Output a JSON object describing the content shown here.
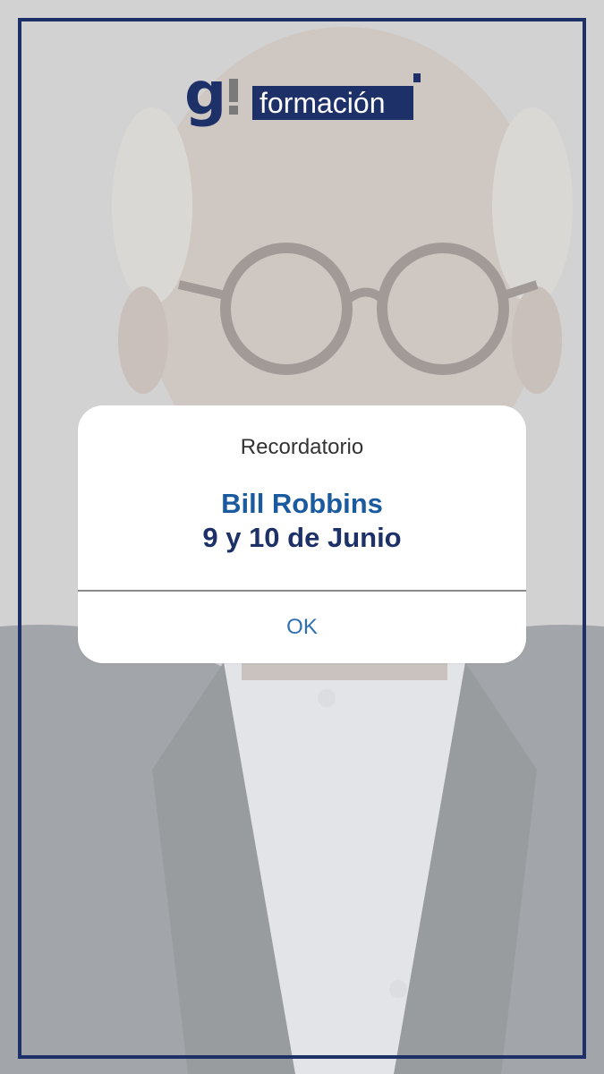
{
  "brand": {
    "mark": "g",
    "label": "formación"
  },
  "dialog": {
    "title": "Recordatorio",
    "name": "Bill Robbins",
    "date": "9 y 10 de Junio",
    "ok_label": "OK"
  },
  "colors": {
    "frame": "#1d3168",
    "name": "#1a5a9e",
    "date": "#1d3168",
    "ok": "#2f6fb3"
  }
}
